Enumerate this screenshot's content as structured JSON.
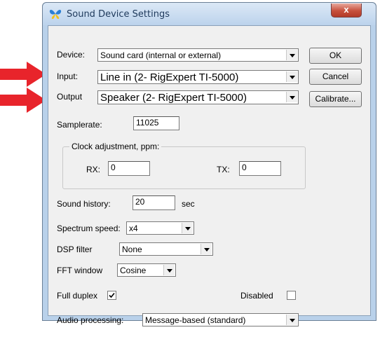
{
  "window": {
    "title": "Sound Device Settings",
    "close_glyph": "x"
  },
  "device": {
    "label": "Device:",
    "value": "Sound card (internal or external)"
  },
  "input": {
    "label": "Input:",
    "value": "Line in (2- RigExpert TI-5000)"
  },
  "output": {
    "label": "Output",
    "value": "Speaker (2- RigExpert TI-5000)"
  },
  "buttons": {
    "ok": "OK",
    "cancel": "Cancel",
    "calibrate": "Calibrate..."
  },
  "samplerate": {
    "label": "Samplerate:",
    "value": "11025"
  },
  "clock": {
    "title": "Clock adjustment, ppm:",
    "rx_label": "RX:",
    "rx_value": "0",
    "tx_label": "TX:",
    "tx_value": "0"
  },
  "sound_history": {
    "label": "Sound history:",
    "value": "20",
    "unit": "sec"
  },
  "spectrum_speed": {
    "label": "Spectrum speed:",
    "value": "x4"
  },
  "dsp_filter": {
    "label": "DSP filter",
    "value": "None"
  },
  "fft_window": {
    "label": "FFT window",
    "value": "Cosine"
  },
  "full_duplex": {
    "label": "Full duplex",
    "checked": true
  },
  "disabled": {
    "label": "Disabled",
    "checked": false
  },
  "audio_processing": {
    "label": "Audio processing:",
    "value": "Message-based (standard)"
  },
  "colors": {
    "annotation_arrow": "#e8242b",
    "title_text": "#1e395b"
  }
}
